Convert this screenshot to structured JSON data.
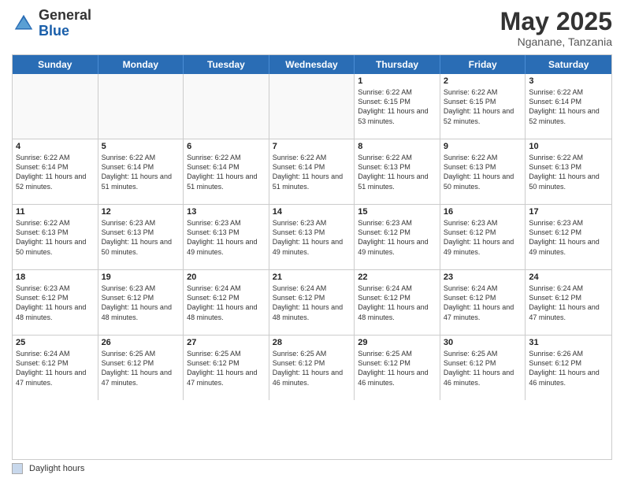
{
  "header": {
    "logo_general": "General",
    "logo_blue": "Blue",
    "month_year": "May 2025",
    "location": "Nganane, Tanzania"
  },
  "day_headers": [
    "Sunday",
    "Monday",
    "Tuesday",
    "Wednesday",
    "Thursday",
    "Friday",
    "Saturday"
  ],
  "footer": {
    "legend_label": "Daylight hours"
  },
  "weeks": [
    [
      {
        "day": "",
        "info": "",
        "empty": true
      },
      {
        "day": "",
        "info": "",
        "empty": true
      },
      {
        "day": "",
        "info": "",
        "empty": true
      },
      {
        "day": "",
        "info": "",
        "empty": true
      },
      {
        "day": "1",
        "info": "Sunrise: 6:22 AM\nSunset: 6:15 PM\nDaylight: 11 hours\nand 53 minutes."
      },
      {
        "day": "2",
        "info": "Sunrise: 6:22 AM\nSunset: 6:15 PM\nDaylight: 11 hours\nand 52 minutes."
      },
      {
        "day": "3",
        "info": "Sunrise: 6:22 AM\nSunset: 6:14 PM\nDaylight: 11 hours\nand 52 minutes."
      }
    ],
    [
      {
        "day": "4",
        "info": "Sunrise: 6:22 AM\nSunset: 6:14 PM\nDaylight: 11 hours\nand 52 minutes."
      },
      {
        "day": "5",
        "info": "Sunrise: 6:22 AM\nSunset: 6:14 PM\nDaylight: 11 hours\nand 51 minutes."
      },
      {
        "day": "6",
        "info": "Sunrise: 6:22 AM\nSunset: 6:14 PM\nDaylight: 11 hours\nand 51 minutes."
      },
      {
        "day": "7",
        "info": "Sunrise: 6:22 AM\nSunset: 6:14 PM\nDaylight: 11 hours\nand 51 minutes."
      },
      {
        "day": "8",
        "info": "Sunrise: 6:22 AM\nSunset: 6:13 PM\nDaylight: 11 hours\nand 51 minutes."
      },
      {
        "day": "9",
        "info": "Sunrise: 6:22 AM\nSunset: 6:13 PM\nDaylight: 11 hours\nand 50 minutes."
      },
      {
        "day": "10",
        "info": "Sunrise: 6:22 AM\nSunset: 6:13 PM\nDaylight: 11 hours\nand 50 minutes."
      }
    ],
    [
      {
        "day": "11",
        "info": "Sunrise: 6:22 AM\nSunset: 6:13 PM\nDaylight: 11 hours\nand 50 minutes."
      },
      {
        "day": "12",
        "info": "Sunrise: 6:23 AM\nSunset: 6:13 PM\nDaylight: 11 hours\nand 50 minutes."
      },
      {
        "day": "13",
        "info": "Sunrise: 6:23 AM\nSunset: 6:13 PM\nDaylight: 11 hours\nand 49 minutes."
      },
      {
        "day": "14",
        "info": "Sunrise: 6:23 AM\nSunset: 6:13 PM\nDaylight: 11 hours\nand 49 minutes."
      },
      {
        "day": "15",
        "info": "Sunrise: 6:23 AM\nSunset: 6:12 PM\nDaylight: 11 hours\nand 49 minutes."
      },
      {
        "day": "16",
        "info": "Sunrise: 6:23 AM\nSunset: 6:12 PM\nDaylight: 11 hours\nand 49 minutes."
      },
      {
        "day": "17",
        "info": "Sunrise: 6:23 AM\nSunset: 6:12 PM\nDaylight: 11 hours\nand 49 minutes."
      }
    ],
    [
      {
        "day": "18",
        "info": "Sunrise: 6:23 AM\nSunset: 6:12 PM\nDaylight: 11 hours\nand 48 minutes."
      },
      {
        "day": "19",
        "info": "Sunrise: 6:23 AM\nSunset: 6:12 PM\nDaylight: 11 hours\nand 48 minutes."
      },
      {
        "day": "20",
        "info": "Sunrise: 6:24 AM\nSunset: 6:12 PM\nDaylight: 11 hours\nand 48 minutes."
      },
      {
        "day": "21",
        "info": "Sunrise: 6:24 AM\nSunset: 6:12 PM\nDaylight: 11 hours\nand 48 minutes."
      },
      {
        "day": "22",
        "info": "Sunrise: 6:24 AM\nSunset: 6:12 PM\nDaylight: 11 hours\nand 48 minutes."
      },
      {
        "day": "23",
        "info": "Sunrise: 6:24 AM\nSunset: 6:12 PM\nDaylight: 11 hours\nand 47 minutes."
      },
      {
        "day": "24",
        "info": "Sunrise: 6:24 AM\nSunset: 6:12 PM\nDaylight: 11 hours\nand 47 minutes."
      }
    ],
    [
      {
        "day": "25",
        "info": "Sunrise: 6:24 AM\nSunset: 6:12 PM\nDaylight: 11 hours\nand 47 minutes."
      },
      {
        "day": "26",
        "info": "Sunrise: 6:25 AM\nSunset: 6:12 PM\nDaylight: 11 hours\nand 47 minutes."
      },
      {
        "day": "27",
        "info": "Sunrise: 6:25 AM\nSunset: 6:12 PM\nDaylight: 11 hours\nand 47 minutes."
      },
      {
        "day": "28",
        "info": "Sunrise: 6:25 AM\nSunset: 6:12 PM\nDaylight: 11 hours\nand 46 minutes."
      },
      {
        "day": "29",
        "info": "Sunrise: 6:25 AM\nSunset: 6:12 PM\nDaylight: 11 hours\nand 46 minutes."
      },
      {
        "day": "30",
        "info": "Sunrise: 6:25 AM\nSunset: 6:12 PM\nDaylight: 11 hours\nand 46 minutes."
      },
      {
        "day": "31",
        "info": "Sunrise: 6:26 AM\nSunset: 6:12 PM\nDaylight: 11 hours\nand 46 minutes."
      }
    ]
  ]
}
